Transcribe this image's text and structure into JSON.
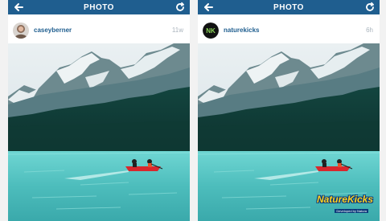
{
  "left_post": {
    "header": {
      "title": "PHOTO"
    },
    "user": {
      "username": "caseyberner",
      "time": "11w"
    }
  },
  "right_post": {
    "header": {
      "title": "PHOTO"
    },
    "user": {
      "username": "naturekicks",
      "time": "6h",
      "avatar_text": "NK"
    },
    "watermark": {
      "text": "NatureKicks",
      "subtext": "Developed by Natura"
    }
  },
  "colors": {
    "header": "#1f5e8f",
    "username": "#1f5e8f",
    "time": "#aab4bd",
    "watermark": "#ffd21e"
  },
  "icons": [
    "back-arrow-icon",
    "refresh-icon"
  ]
}
